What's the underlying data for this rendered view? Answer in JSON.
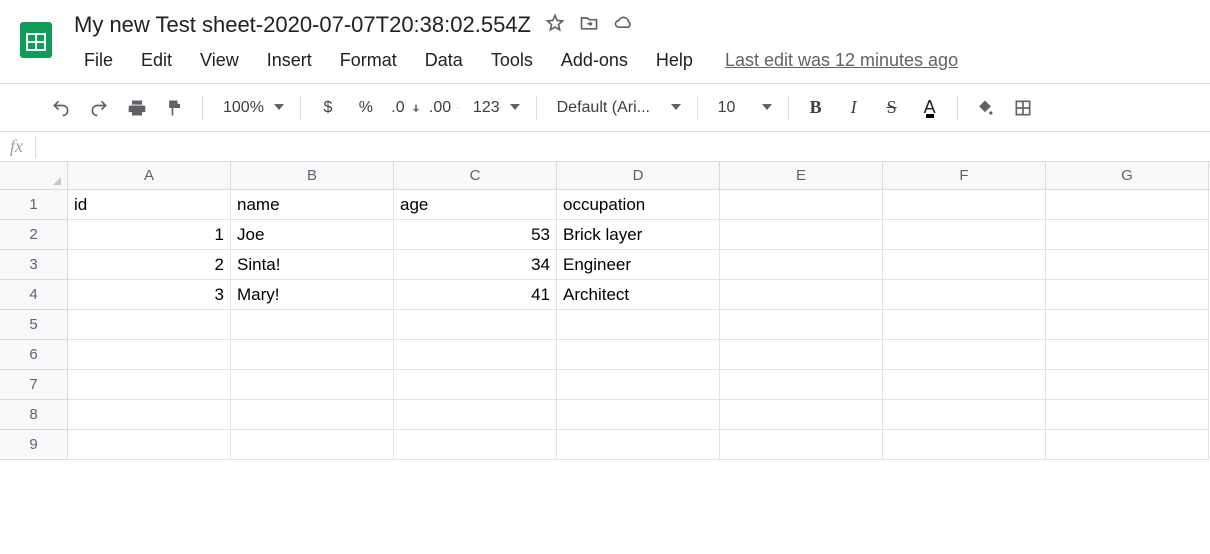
{
  "header": {
    "title": "My new Test sheet-2020-07-07T20:38:02.554Z",
    "menu": [
      "File",
      "Edit",
      "View",
      "Insert",
      "Format",
      "Data",
      "Tools",
      "Add-ons",
      "Help"
    ],
    "last_edit": "Last edit was 12 minutes ago"
  },
  "toolbar": {
    "zoom": "100%",
    "currency": "$",
    "percent": "%",
    "dec_dec": ".0",
    "inc_dec": ".00",
    "num_format": "123",
    "font": "Default (Ari...",
    "font_size": "10",
    "bold": "B",
    "italic": "I",
    "strike": "S",
    "text_color": "A"
  },
  "formula_bar": {
    "label": "fx",
    "value": ""
  },
  "grid": {
    "columns": [
      "A",
      "B",
      "C",
      "D",
      "E",
      "F",
      "G"
    ],
    "row_numbers": [
      "1",
      "2",
      "3",
      "4",
      "5",
      "6",
      "7",
      "8",
      "9"
    ],
    "cells": {
      "r1": {
        "A": "id",
        "B": "name",
        "C": "age",
        "D": "occupation"
      },
      "r2": {
        "A": "1",
        "B": "Joe",
        "C": "53",
        "D": "Brick layer"
      },
      "r3": {
        "A": "2",
        "B": "Sinta!",
        "C": "34",
        "D": "Engineer"
      },
      "r4": {
        "A": "3",
        "B": "Mary!",
        "C": "41",
        "D": "Architect"
      }
    }
  }
}
